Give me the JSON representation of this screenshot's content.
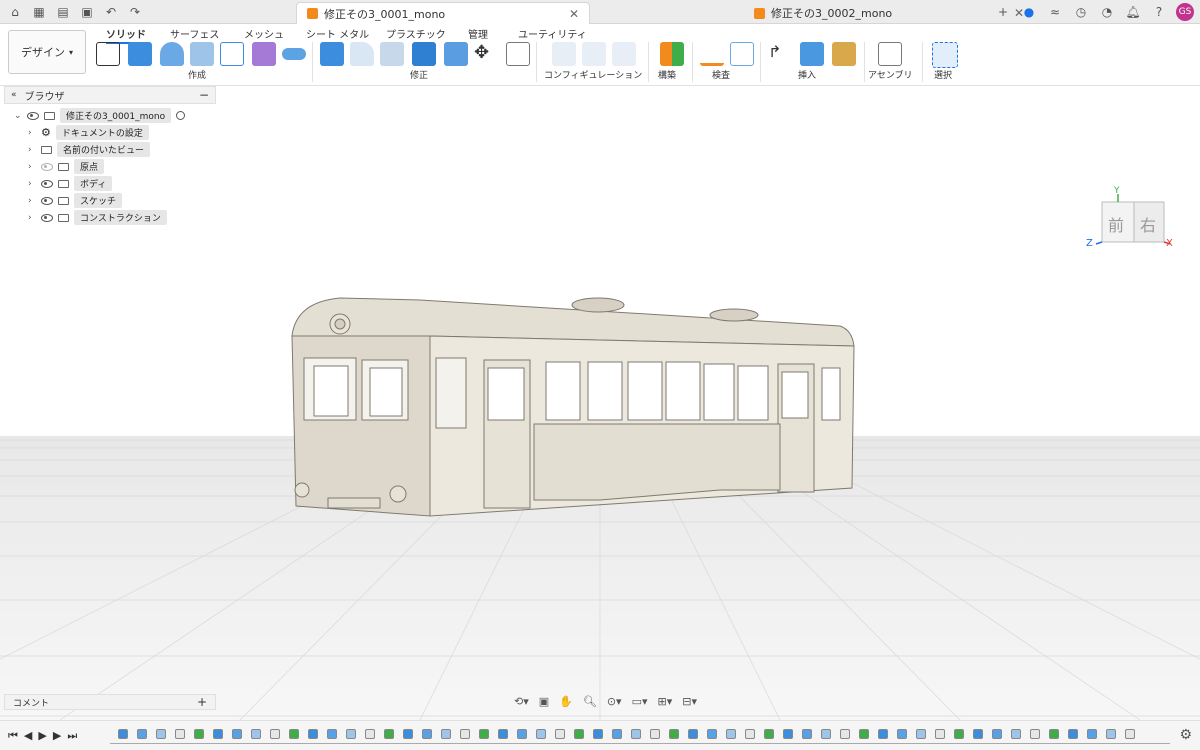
{
  "appbar": {
    "tab1": "修正その3_0001_mono",
    "tab2": "修正その3_0002_mono",
    "user_initials": "GS"
  },
  "toolbar": {
    "design_label": "デザイン",
    "subtabs": [
      "ソリッド",
      "サーフェス",
      "メッシュ",
      "シート メタル",
      "プラスチック",
      "管理",
      "ユーティリティ"
    ],
    "groups": [
      "作成",
      "修正",
      "コンフィギュレーション",
      "構築",
      "検査",
      "挿入",
      "アセンブリ",
      "選択"
    ]
  },
  "browser": {
    "title": "ブラウザ",
    "items": [
      {
        "label": "修正その3_0001_mono"
      },
      {
        "label": "ドキュメントの設定"
      },
      {
        "label": "名前の付いたビュー"
      },
      {
        "label": "原点"
      },
      {
        "label": "ボディ"
      },
      {
        "label": "スケッチ"
      },
      {
        "label": "コンストラクション"
      }
    ]
  },
  "viewcube": {
    "front": "前",
    "right": "右",
    "axis_x": "X",
    "axis_y": "Y",
    "axis_z": "Z"
  },
  "comment": {
    "label": "コメント"
  },
  "colors": {
    "accent": "#1a73e8",
    "tab_orange": "#f28a1e",
    "avatar": "#c2328f",
    "model": "#ece8dd",
    "grid": "#d8d8d8"
  }
}
